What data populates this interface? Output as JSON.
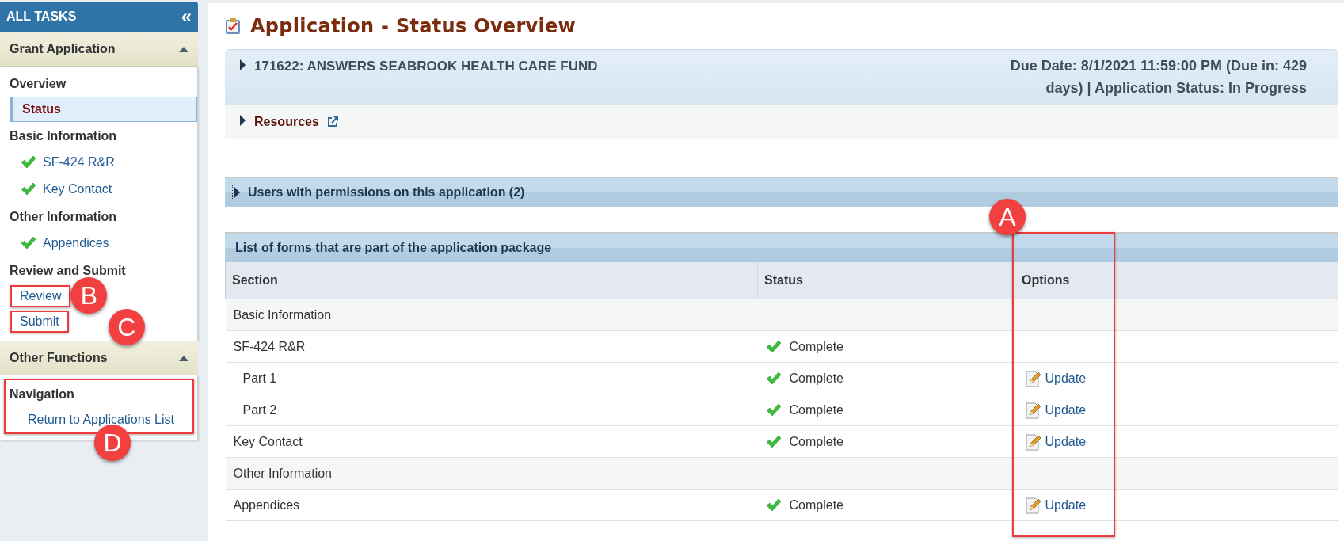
{
  "sidebar": {
    "title": "ALL TASKS",
    "collapse": "«",
    "sections": [
      {
        "title": "Grant Application",
        "expanded": true,
        "groups": [
          {
            "heading": "Overview",
            "items": [
              {
                "label": "Status",
                "selected": true,
                "complete": false
              }
            ]
          },
          {
            "heading": "Basic Information",
            "items": [
              {
                "label": "SF-424 R&R",
                "selected": false,
                "complete": true
              },
              {
                "label": "Key Contact",
                "selected": false,
                "complete": true
              }
            ]
          },
          {
            "heading": "Other Information",
            "items": [
              {
                "label": "Appendices",
                "selected": false,
                "complete": true
              }
            ]
          },
          {
            "heading": "Review and Submit",
            "items": [
              {
                "label": "Review",
                "selected": false,
                "complete": false,
                "callout": "B"
              },
              {
                "label": "Submit",
                "selected": false,
                "complete": false,
                "callout": "C"
              }
            ]
          }
        ]
      },
      {
        "title": "Other Functions",
        "expanded": true,
        "groups": [
          {
            "heading": "Navigation",
            "callout": "D",
            "items": [
              {
                "label": "Return to Applications List",
                "selected": false,
                "complete": false
              }
            ]
          }
        ]
      }
    ]
  },
  "page": {
    "title": "Application - Status Overview"
  },
  "application": {
    "name": "171622: ANSWERS SEABROOK HEALTH CARE FUND",
    "expanded": false,
    "due": "Due Date: 8/1/2021 11:59:00 PM (Due in: 429 days) | Application Status: In Progress",
    "resources": {
      "label": "Resources",
      "expanded": false
    }
  },
  "users_panel": {
    "title": "Users with permissions on this application (2)",
    "expanded": false
  },
  "forms": {
    "title": "List of forms that are part of the application package",
    "columns": [
      {
        "label": "Section"
      },
      {
        "label": "Status"
      },
      {
        "label": "Options",
        "callout": "A"
      }
    ],
    "rows": [
      {
        "section": "Basic Information",
        "kind": "group"
      },
      {
        "section": "SF-424 R&R",
        "kind": "form",
        "status": "Complete",
        "complete": true,
        "children": [
          {
            "section": "Part 1",
            "kind": "form",
            "status": "Complete",
            "complete": true,
            "option": "Update"
          },
          {
            "section": "Part 2",
            "kind": "form",
            "status": "Complete",
            "complete": true,
            "option": "Update"
          }
        ]
      },
      {
        "section": "Key Contact",
        "kind": "form",
        "status": "Complete",
        "complete": true,
        "option": "Update"
      },
      {
        "section": "Other Information",
        "kind": "group"
      },
      {
        "section": "Appendices",
        "kind": "form",
        "status": "Complete",
        "complete": true,
        "option": "Update"
      }
    ]
  }
}
